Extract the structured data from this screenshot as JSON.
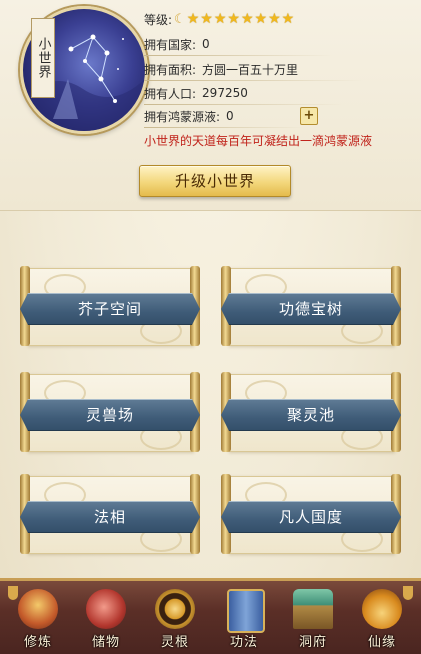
{
  "world": {
    "name": "小世界",
    "level_label": "等级:",
    "level_moons": 1,
    "level_stars": 8,
    "countries_label": "拥有国家:",
    "countries_value": "0",
    "area_label": "拥有面积:",
    "area_value": "方圆一百五十万里",
    "population_label": "拥有人口:",
    "population_value": "297250",
    "essence_label": "拥有鸿蒙源液:",
    "essence_value": "0",
    "plus_glyph": "+",
    "notice": "小世界的天道每百年可凝结出一滴鸿蒙源液",
    "upgrade_label": "升级小世界"
  },
  "buildings": [
    {
      "label": "芥子空间"
    },
    {
      "label": "功德宝树"
    },
    {
      "label": "灵兽场"
    },
    {
      "label": "聚灵池"
    },
    {
      "label": "法相"
    },
    {
      "label": "凡人国度"
    }
  ],
  "nav": [
    {
      "label": "修炼",
      "icon": "cultivator-icon"
    },
    {
      "label": "储物",
      "icon": "treasure-bag-icon"
    },
    {
      "label": "灵根",
      "icon": "spirit-root-icon"
    },
    {
      "label": "功法",
      "icon": "scripture-icon"
    },
    {
      "label": "洞府",
      "icon": "cave-mansion-icon"
    },
    {
      "label": "仙缘",
      "icon": "gourd-icon"
    }
  ],
  "colors": {
    "accent_gold": "#f0b81f",
    "notice_red": "#c0221a",
    "band_blue": "#3f5c78",
    "nav_brown": "#5b2f27"
  }
}
